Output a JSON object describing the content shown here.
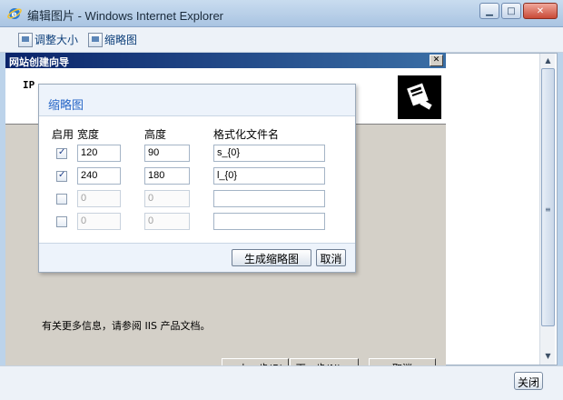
{
  "window": {
    "title": "编辑图片 - Windows Internet Explorer"
  },
  "toolbar": {
    "resize_label": "调整大小",
    "thumbnail_label": "缩略图"
  },
  "wizard": {
    "title": "网站创建向导",
    "header_text": "IP",
    "info_text": "有关更多信息，请参阅 IIS 产品文档。",
    "back_label": "< 上一步(B)",
    "next_label": "下一步(N) >",
    "cancel_label": "取消"
  },
  "dialog": {
    "title": "缩略图",
    "columns": {
      "enable": "启用",
      "width": "宽度",
      "height": "高度",
      "format": "格式化文件名"
    },
    "rows": [
      {
        "checked": true,
        "width": "120",
        "height": "90",
        "format": "s_{0}"
      },
      {
        "checked": true,
        "width": "240",
        "height": "180",
        "format": "l_{0}"
      },
      {
        "checked": false,
        "width": "0",
        "height": "0",
        "format": ""
      },
      {
        "checked": false,
        "width": "0",
        "height": "0",
        "format": ""
      }
    ],
    "generate_label": "生成缩略图",
    "cancel_label": "取消"
  },
  "footer": {
    "close_label": "关闭"
  }
}
